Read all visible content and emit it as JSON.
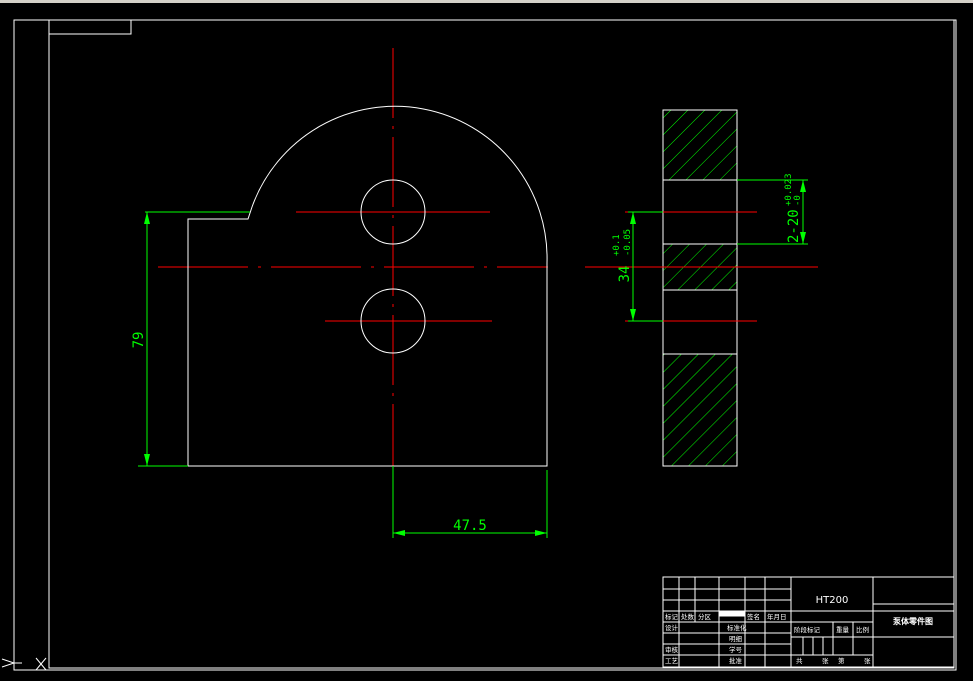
{
  "colors": {
    "background": "#000000",
    "outline": "#ffffff",
    "centerline": "#ff0000",
    "dimension": "#00ff00",
    "hatch": "#00ff00"
  },
  "dimensions": {
    "height": "79",
    "width": "47.5",
    "hole_spacing": "34",
    "hole_spacing_upper_tol": "+0.1",
    "hole_spacing_lower_tol": "-0.05",
    "hole_dia": "2-20",
    "hole_dia_upper_tol": "+0.023",
    "hole_dia_lower_tol": "-0"
  },
  "title_block": {
    "material": "HT200",
    "part_name": "泵体零件图",
    "row_labels_left": [
      "标记",
      "处数",
      "分区",
      "签名",
      "年月日"
    ],
    "design": "设计",
    "standardization": "标准化",
    "review": "审核",
    "process": "工艺",
    "approve": "批准",
    "stage_mark": "阶段标记",
    "weight": "重量",
    "scale": "比例",
    "sheet_total": "共",
    "sheet_no": "第",
    "sheets": "张",
    "catalogue": "明细",
    "student_no": "学号"
  },
  "ucs_icon": "ucs-axis-icon"
}
